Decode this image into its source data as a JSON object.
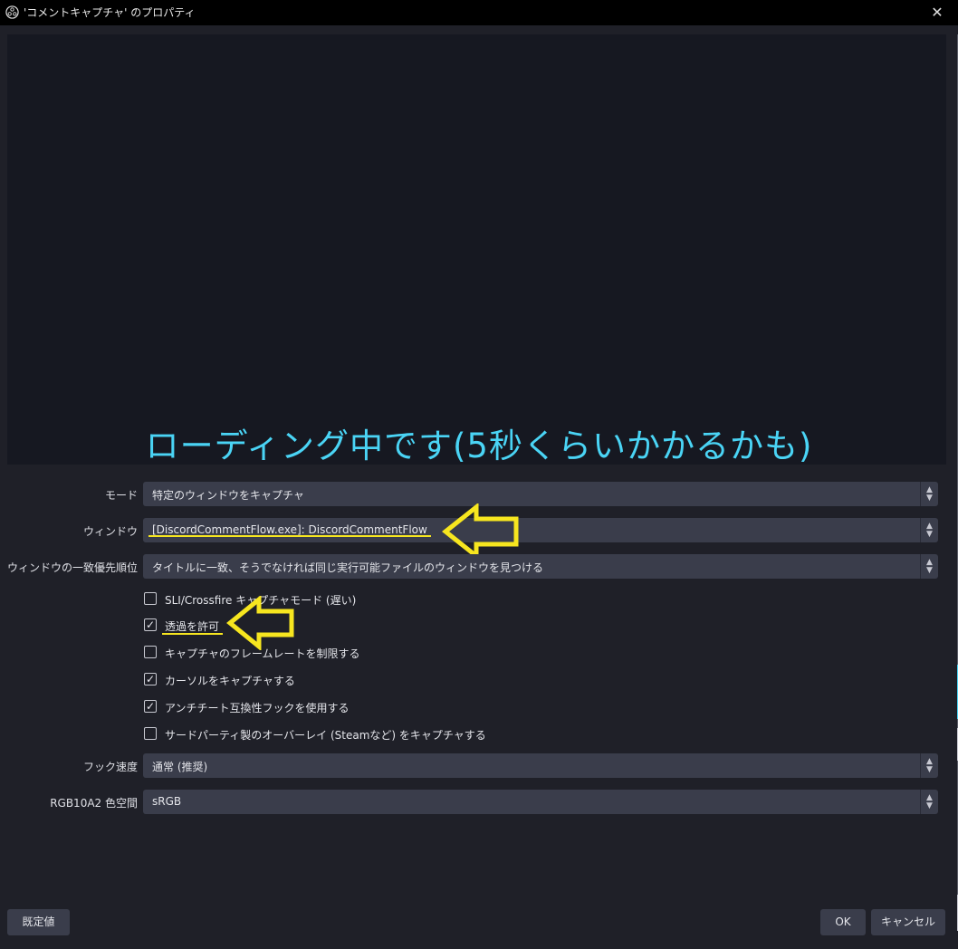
{
  "window": {
    "title": "'コメントキャプチャ' のプロパティ",
    "app_icon": "obs-logo-icon",
    "close_glyph": "✕"
  },
  "preview": {
    "caption": "ローディング中です(5秒くらいかかるかも)"
  },
  "form": {
    "mode": {
      "label": "モード",
      "value": "特定のウィンドウをキャプチャ"
    },
    "window": {
      "label": "ウィンドウ",
      "value": "[DiscordCommentFlow.exe]: DiscordCommentFlow"
    },
    "priority": {
      "label": "ウィンドウの一致優先順位",
      "value": "タイトルに一致、そうでなければ同じ実行可能ファイルのウィンドウを見つける"
    },
    "checkboxes": [
      {
        "label": "SLI/Crossfire キャプチャモード (遅い)",
        "checked": false
      },
      {
        "label": "透過を許可",
        "checked": true
      },
      {
        "label": "キャプチャのフレームレートを制限する",
        "checked": false
      },
      {
        "label": "カーソルをキャプチャする",
        "checked": true
      },
      {
        "label": "アンチチート互換性フックを使用する",
        "checked": true
      },
      {
        "label": "サードパーティ製のオーバーレイ (Steamなど) をキャプチャする",
        "checked": false
      }
    ],
    "hook_speed": {
      "label": "フック速度",
      "value": "通常 (推奨)"
    },
    "color_space": {
      "label": "RGB10A2 色空間",
      "value": "sRGB"
    }
  },
  "buttons": {
    "defaults": "既定値",
    "ok": "OK",
    "cancel": "キャンセル"
  },
  "annotations": {
    "highlight_color": "#f7e61f",
    "caption_color": "#4ad4f5"
  },
  "glyphs": {
    "check": "✓",
    "spin_up": "▲",
    "spin_down": "▼"
  }
}
